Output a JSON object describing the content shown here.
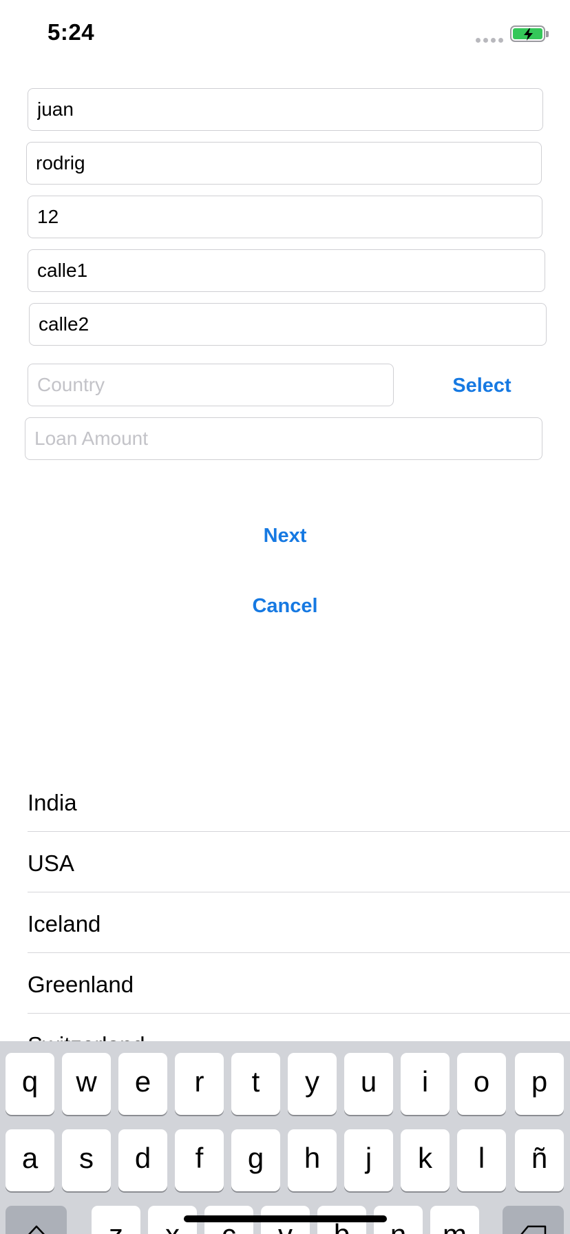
{
  "status_bar": {
    "time": "5:24"
  },
  "form": {
    "first_name": "juan",
    "last_name": "rodrig",
    "age": "12",
    "address_line1": "calle1",
    "address_line2": "calle2",
    "country_placeholder": "Country",
    "loan_amount_placeholder": "Loan Amount",
    "select_label": "Select",
    "next_label": "Next",
    "cancel_label": "Cancel"
  },
  "countries": [
    "India",
    "USA",
    "Iceland",
    "Greenland",
    "Switzerland"
  ],
  "keyboard": {
    "row1": [
      "q",
      "w",
      "e",
      "r",
      "t",
      "y",
      "u",
      "i",
      "o",
      "p"
    ],
    "row2": [
      "a",
      "s",
      "d",
      "f",
      "g",
      "h",
      "j",
      "k",
      "l",
      "ñ"
    ],
    "row3": [
      "z",
      "x",
      "c",
      "v",
      "b",
      "n",
      "m"
    ]
  },
  "colors": {
    "accent": "#1679e2",
    "battery": "#34c759",
    "keyboard_bg": "#d2d4d9"
  }
}
